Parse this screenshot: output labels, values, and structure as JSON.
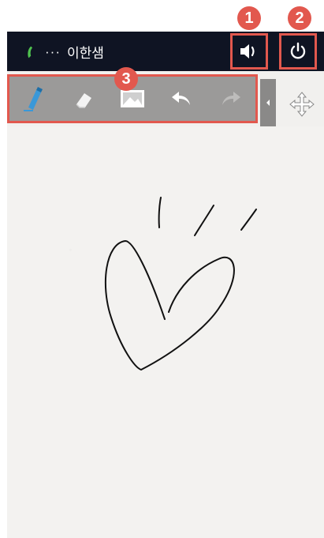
{
  "call": {
    "caller_name": "이한샘",
    "dots": "···"
  },
  "badges": {
    "speaker": "1",
    "end_call": "2",
    "toolbar": "3"
  },
  "colors": {
    "badge": "#e2584e",
    "topbar": "#0f1423",
    "pen": "#3a98d8",
    "highlight": "#e2584e"
  },
  "toolbar": {
    "tools": [
      "pen-icon",
      "eraser-icon",
      "image-icon",
      "undo-icon",
      "redo-icon"
    ]
  }
}
